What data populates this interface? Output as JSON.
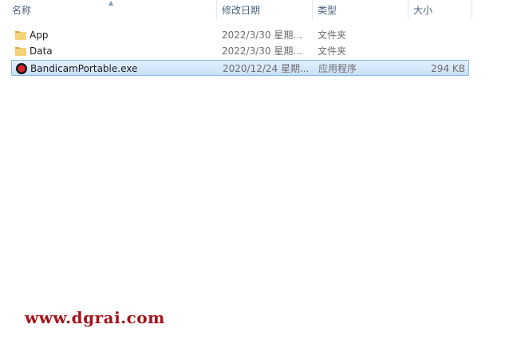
{
  "columns": {
    "name": "名称",
    "modified": "修改日期",
    "type": "类型",
    "size": "大小"
  },
  "files": [
    {
      "name": "App",
      "modified": "2022/3/30 星期...",
      "type": "文件夹",
      "size": "",
      "icon": "folder-icon"
    },
    {
      "name": "Data",
      "modified": "2022/3/30 星期...",
      "type": "文件夹",
      "size": "",
      "icon": "folder-icon"
    },
    {
      "name": "BandicamPortable.exe",
      "modified": "2020/12/24 星期...",
      "type": "应用程序",
      "size": "294 KB",
      "icon": "bandicam-app-icon",
      "selected": true
    }
  ],
  "watermark": "www.dgrai.com",
  "colors": {
    "selection_bg": "#cce4f7",
    "selection_border": "#86b6e8",
    "watermark": "#a3131b",
    "folder": "#e8c25a"
  }
}
